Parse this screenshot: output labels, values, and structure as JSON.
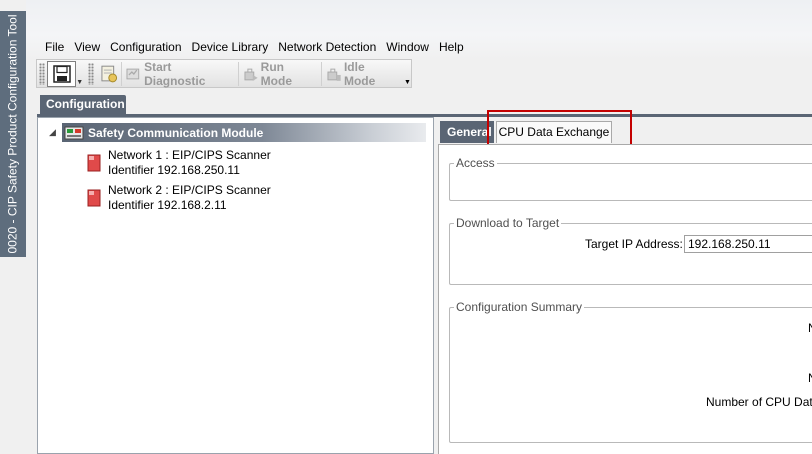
{
  "app": {
    "title": "0020 - CIP Safety Product Configuration Tool"
  },
  "menu": {
    "items": [
      "File",
      "View",
      "Configuration",
      "Device Library",
      "Network Detection",
      "Window",
      "Help"
    ]
  },
  "toolbar": {
    "start_diagnostic": "Start Diagnostic",
    "run_mode": "Run Mode",
    "idle_mode": "Idle Mode"
  },
  "panel": {
    "configuration_tab": "Configuration"
  },
  "tree": {
    "root": "Safety Communication Module",
    "nodes": [
      {
        "line1": "Network 1 : EIP/CIPS Scanner",
        "line2": "Identifier 192.168.250.11"
      },
      {
        "line1": "Network 2 : EIP/CIPS Scanner",
        "line2": "Identifier 192.168.2.11"
      }
    ]
  },
  "tabs": {
    "general": "General",
    "cpu_data_exchange": "CPU Data Exchange"
  },
  "groups": {
    "access": {
      "title": "Access"
    },
    "download": {
      "title": "Download to Target",
      "target_ip_label": "Target IP Address:",
      "target_ip_value": "192.168.250.11"
    },
    "summary": {
      "title": "Configuration Summary",
      "row1_partial": "N",
      "row2_partial": "N",
      "row3_partial": "Number of CPU Data"
    }
  },
  "colors": {
    "header_dark": "#5a6574",
    "title_strip": "#5e6d7d",
    "highlight": "#c40000"
  }
}
